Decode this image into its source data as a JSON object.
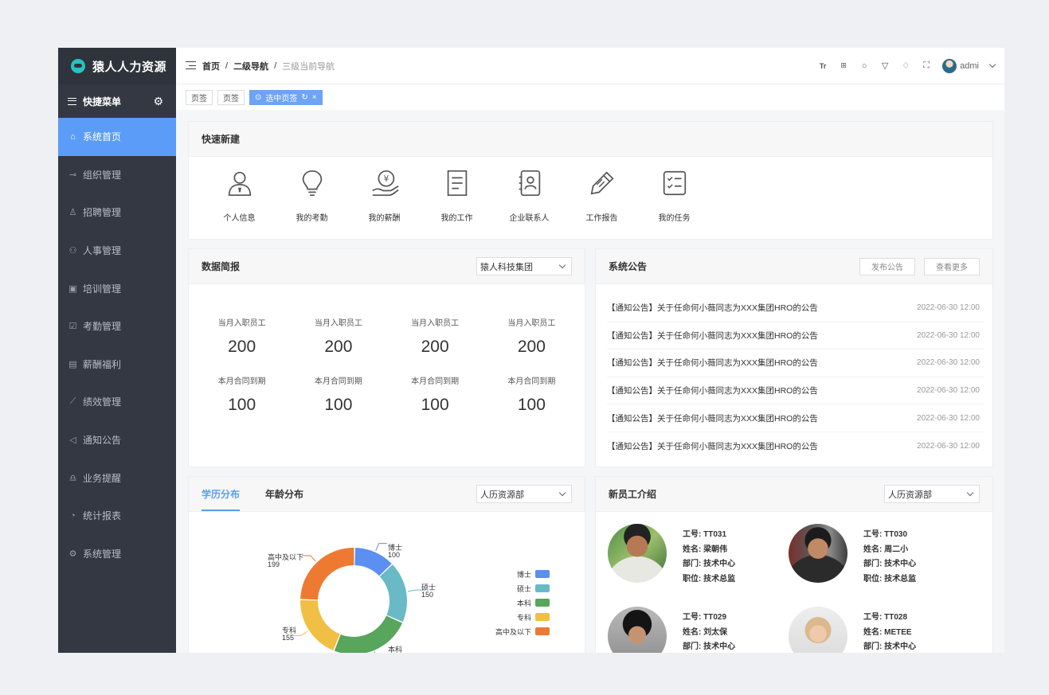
{
  "app": {
    "title": "猿人人力资源"
  },
  "sidebar": {
    "quick_menu_label": "快捷菜单",
    "items": [
      {
        "label": "系统首页",
        "icon": "home-icon",
        "active": true
      },
      {
        "label": "组织管理",
        "icon": "org-icon"
      },
      {
        "label": "招聘管理",
        "icon": "user-icon"
      },
      {
        "label": "人事管理",
        "icon": "team-icon"
      },
      {
        "label": "培训管理",
        "icon": "training-icon"
      },
      {
        "label": "考勤管理",
        "icon": "check-icon"
      },
      {
        "label": "薪酬福利",
        "icon": "wallet-icon"
      },
      {
        "label": "绩效管理",
        "icon": "chart-icon"
      },
      {
        "label": "通知公告",
        "icon": "megaphone-icon"
      },
      {
        "label": "业务提醒",
        "icon": "bell-icon"
      },
      {
        "label": "统计报表",
        "icon": "pie-icon"
      },
      {
        "label": "系统管理",
        "icon": "settings-icon"
      }
    ]
  },
  "header": {
    "breadcrumb": [
      "首页",
      "二级导航",
      "三级当前导航"
    ],
    "user": "admi"
  },
  "tabs": {
    "tab1": "页签",
    "tab2": "页签",
    "selected": "选中页签"
  },
  "quick_create": {
    "title": "快速新建",
    "items": [
      "个人信息",
      "我的考勤",
      "我的薪酬",
      "我的工作",
      "企业联系人",
      "工作报告",
      "我的任务"
    ]
  },
  "data_brief": {
    "title": "数据简报",
    "company": "猿人科技集团",
    "stats": [
      {
        "label": "当月入职员工",
        "value": "200"
      },
      {
        "label": "当月入职员工",
        "value": "200"
      },
      {
        "label": "当月入职员工",
        "value": "200"
      },
      {
        "label": "当月入职员工",
        "value": "200"
      },
      {
        "label": "本月合同到期",
        "value": "100"
      },
      {
        "label": "本月合同到期",
        "value": "100"
      },
      {
        "label": "本月合同到期",
        "value": "100"
      },
      {
        "label": "本月合同到期",
        "value": "100"
      }
    ]
  },
  "announcements": {
    "title": "系统公告",
    "publish": "发布公告",
    "more": "查看更多",
    "items": [
      {
        "text": "【通知公告】关于任命何小薇同志为XXX集团HRO的公告",
        "date": "2022-06-30 12:00"
      },
      {
        "text": "【通知公告】关于任命何小薇同志为XXX集团HRO的公告",
        "date": "2022-06-30 12:00"
      },
      {
        "text": "【通知公告】关于任命何小薇同志为XXX集团HRO的公告",
        "date": "2022-06-30 12:00"
      },
      {
        "text": "【通知公告】关于任命何小薇同志为XXX集团HRO的公告",
        "date": "2022-06-30 12:00"
      },
      {
        "text": "【通知公告】关于任命何小薇同志为XXX集团HRO的公告",
        "date": "2022-06-30 12:00"
      },
      {
        "text": "【通知公告】关于任命何小薇同志为XXX集团HRO的公告",
        "date": "2022-06-30 12:00"
      }
    ]
  },
  "distribution": {
    "tab_edu": "学历分布",
    "tab_age": "年龄分布",
    "dept": "人历资源部"
  },
  "chart_data": {
    "type": "pie",
    "donut": true,
    "categories": [
      "博士",
      "硕士",
      "本科",
      "专科",
      "高中及以下"
    ],
    "values": [
      100,
      150,
      null,
      155,
      199
    ],
    "colors": [
      "#5b8ff0",
      "#69bac6",
      "#58a55c",
      "#f0bf44",
      "#ee7a32"
    ],
    "legend_position": "right"
  },
  "new_employees": {
    "title": "新员工介绍",
    "dept": "人历资源部",
    "items": [
      {
        "id_label": "工号:",
        "id": "TT031",
        "name_label": "姓名:",
        "name": "梁朝伟",
        "dept_label": "部门:",
        "dept": "技术中心",
        "pos_label": "职位:",
        "pos": "技术总监"
      },
      {
        "id_label": "工号:",
        "id": "TT030",
        "name_label": "姓名:",
        "name": "周二小",
        "dept_label": "部门:",
        "dept": "技术中心",
        "pos_label": "职位:",
        "pos": "技术总监"
      },
      {
        "id_label": "工号:",
        "id": "TT029",
        "name_label": "姓名:",
        "name": "刘太保",
        "dept_label": "部门:",
        "dept": "技术中心"
      },
      {
        "id_label": "工号:",
        "id": "TT028",
        "name_label": "姓名:",
        "name": "METEE",
        "dept_label": "部门:",
        "dept": "技术中心"
      }
    ]
  }
}
